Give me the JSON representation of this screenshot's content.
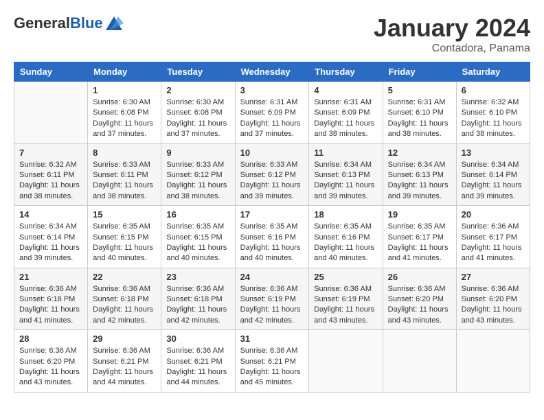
{
  "logo": {
    "general": "General",
    "blue": "Blue"
  },
  "header": {
    "month": "January 2024",
    "location": "Contadora, Panama"
  },
  "weekdays": [
    "Sunday",
    "Monday",
    "Tuesday",
    "Wednesday",
    "Thursday",
    "Friday",
    "Saturday"
  ],
  "weeks": [
    [
      {
        "day": "",
        "sunrise": "",
        "sunset": "",
        "daylight": ""
      },
      {
        "day": "1",
        "sunrise": "Sunrise: 6:30 AM",
        "sunset": "Sunset: 6:08 PM",
        "daylight": "Daylight: 11 hours and 37 minutes."
      },
      {
        "day": "2",
        "sunrise": "Sunrise: 6:30 AM",
        "sunset": "Sunset: 6:08 PM",
        "daylight": "Daylight: 11 hours and 37 minutes."
      },
      {
        "day": "3",
        "sunrise": "Sunrise: 6:31 AM",
        "sunset": "Sunset: 6:09 PM",
        "daylight": "Daylight: 11 hours and 37 minutes."
      },
      {
        "day": "4",
        "sunrise": "Sunrise: 6:31 AM",
        "sunset": "Sunset: 6:09 PM",
        "daylight": "Daylight: 11 hours and 38 minutes."
      },
      {
        "day": "5",
        "sunrise": "Sunrise: 6:31 AM",
        "sunset": "Sunset: 6:10 PM",
        "daylight": "Daylight: 11 hours and 38 minutes."
      },
      {
        "day": "6",
        "sunrise": "Sunrise: 6:32 AM",
        "sunset": "Sunset: 6:10 PM",
        "daylight": "Daylight: 11 hours and 38 minutes."
      }
    ],
    [
      {
        "day": "7",
        "sunrise": "Sunrise: 6:32 AM",
        "sunset": "Sunset: 6:11 PM",
        "daylight": "Daylight: 11 hours and 38 minutes."
      },
      {
        "day": "8",
        "sunrise": "Sunrise: 6:33 AM",
        "sunset": "Sunset: 6:11 PM",
        "daylight": "Daylight: 11 hours and 38 minutes."
      },
      {
        "day": "9",
        "sunrise": "Sunrise: 6:33 AM",
        "sunset": "Sunset: 6:12 PM",
        "daylight": "Daylight: 11 hours and 38 minutes."
      },
      {
        "day": "10",
        "sunrise": "Sunrise: 6:33 AM",
        "sunset": "Sunset: 6:12 PM",
        "daylight": "Daylight: 11 hours and 39 minutes."
      },
      {
        "day": "11",
        "sunrise": "Sunrise: 6:34 AM",
        "sunset": "Sunset: 6:13 PM",
        "daylight": "Daylight: 11 hours and 39 minutes."
      },
      {
        "day": "12",
        "sunrise": "Sunrise: 6:34 AM",
        "sunset": "Sunset: 6:13 PM",
        "daylight": "Daylight: 11 hours and 39 minutes."
      },
      {
        "day": "13",
        "sunrise": "Sunrise: 6:34 AM",
        "sunset": "Sunset: 6:14 PM",
        "daylight": "Daylight: 11 hours and 39 minutes."
      }
    ],
    [
      {
        "day": "14",
        "sunrise": "Sunrise: 6:34 AM",
        "sunset": "Sunset: 6:14 PM",
        "daylight": "Daylight: 11 hours and 39 minutes."
      },
      {
        "day": "15",
        "sunrise": "Sunrise: 6:35 AM",
        "sunset": "Sunset: 6:15 PM",
        "daylight": "Daylight: 11 hours and 40 minutes."
      },
      {
        "day": "16",
        "sunrise": "Sunrise: 6:35 AM",
        "sunset": "Sunset: 6:15 PM",
        "daylight": "Daylight: 11 hours and 40 minutes."
      },
      {
        "day": "17",
        "sunrise": "Sunrise: 6:35 AM",
        "sunset": "Sunset: 6:16 PM",
        "daylight": "Daylight: 11 hours and 40 minutes."
      },
      {
        "day": "18",
        "sunrise": "Sunrise: 6:35 AM",
        "sunset": "Sunset: 6:16 PM",
        "daylight": "Daylight: 11 hours and 40 minutes."
      },
      {
        "day": "19",
        "sunrise": "Sunrise: 6:35 AM",
        "sunset": "Sunset: 6:17 PM",
        "daylight": "Daylight: 11 hours and 41 minutes."
      },
      {
        "day": "20",
        "sunrise": "Sunrise: 6:36 AM",
        "sunset": "Sunset: 6:17 PM",
        "daylight": "Daylight: 11 hours and 41 minutes."
      }
    ],
    [
      {
        "day": "21",
        "sunrise": "Sunrise: 6:36 AM",
        "sunset": "Sunset: 6:18 PM",
        "daylight": "Daylight: 11 hours and 41 minutes."
      },
      {
        "day": "22",
        "sunrise": "Sunrise: 6:36 AM",
        "sunset": "Sunset: 6:18 PM",
        "daylight": "Daylight: 11 hours and 42 minutes."
      },
      {
        "day": "23",
        "sunrise": "Sunrise: 6:36 AM",
        "sunset": "Sunset: 6:18 PM",
        "daylight": "Daylight: 11 hours and 42 minutes."
      },
      {
        "day": "24",
        "sunrise": "Sunrise: 6:36 AM",
        "sunset": "Sunset: 6:19 PM",
        "daylight": "Daylight: 11 hours and 42 minutes."
      },
      {
        "day": "25",
        "sunrise": "Sunrise: 6:36 AM",
        "sunset": "Sunset: 6:19 PM",
        "daylight": "Daylight: 11 hours and 43 minutes."
      },
      {
        "day": "26",
        "sunrise": "Sunrise: 6:36 AM",
        "sunset": "Sunset: 6:20 PM",
        "daylight": "Daylight: 11 hours and 43 minutes."
      },
      {
        "day": "27",
        "sunrise": "Sunrise: 6:36 AM",
        "sunset": "Sunset: 6:20 PM",
        "daylight": "Daylight: 11 hours and 43 minutes."
      }
    ],
    [
      {
        "day": "28",
        "sunrise": "Sunrise: 6:36 AM",
        "sunset": "Sunset: 6:20 PM",
        "daylight": "Daylight: 11 hours and 43 minutes."
      },
      {
        "day": "29",
        "sunrise": "Sunrise: 6:36 AM",
        "sunset": "Sunset: 6:21 PM",
        "daylight": "Daylight: 11 hours and 44 minutes."
      },
      {
        "day": "30",
        "sunrise": "Sunrise: 6:36 AM",
        "sunset": "Sunset: 6:21 PM",
        "daylight": "Daylight: 11 hours and 44 minutes."
      },
      {
        "day": "31",
        "sunrise": "Sunrise: 6:36 AM",
        "sunset": "Sunset: 6:21 PM",
        "daylight": "Daylight: 11 hours and 45 minutes."
      },
      {
        "day": "",
        "sunrise": "",
        "sunset": "",
        "daylight": ""
      },
      {
        "day": "",
        "sunrise": "",
        "sunset": "",
        "daylight": ""
      },
      {
        "day": "",
        "sunrise": "",
        "sunset": "",
        "daylight": ""
      }
    ]
  ]
}
